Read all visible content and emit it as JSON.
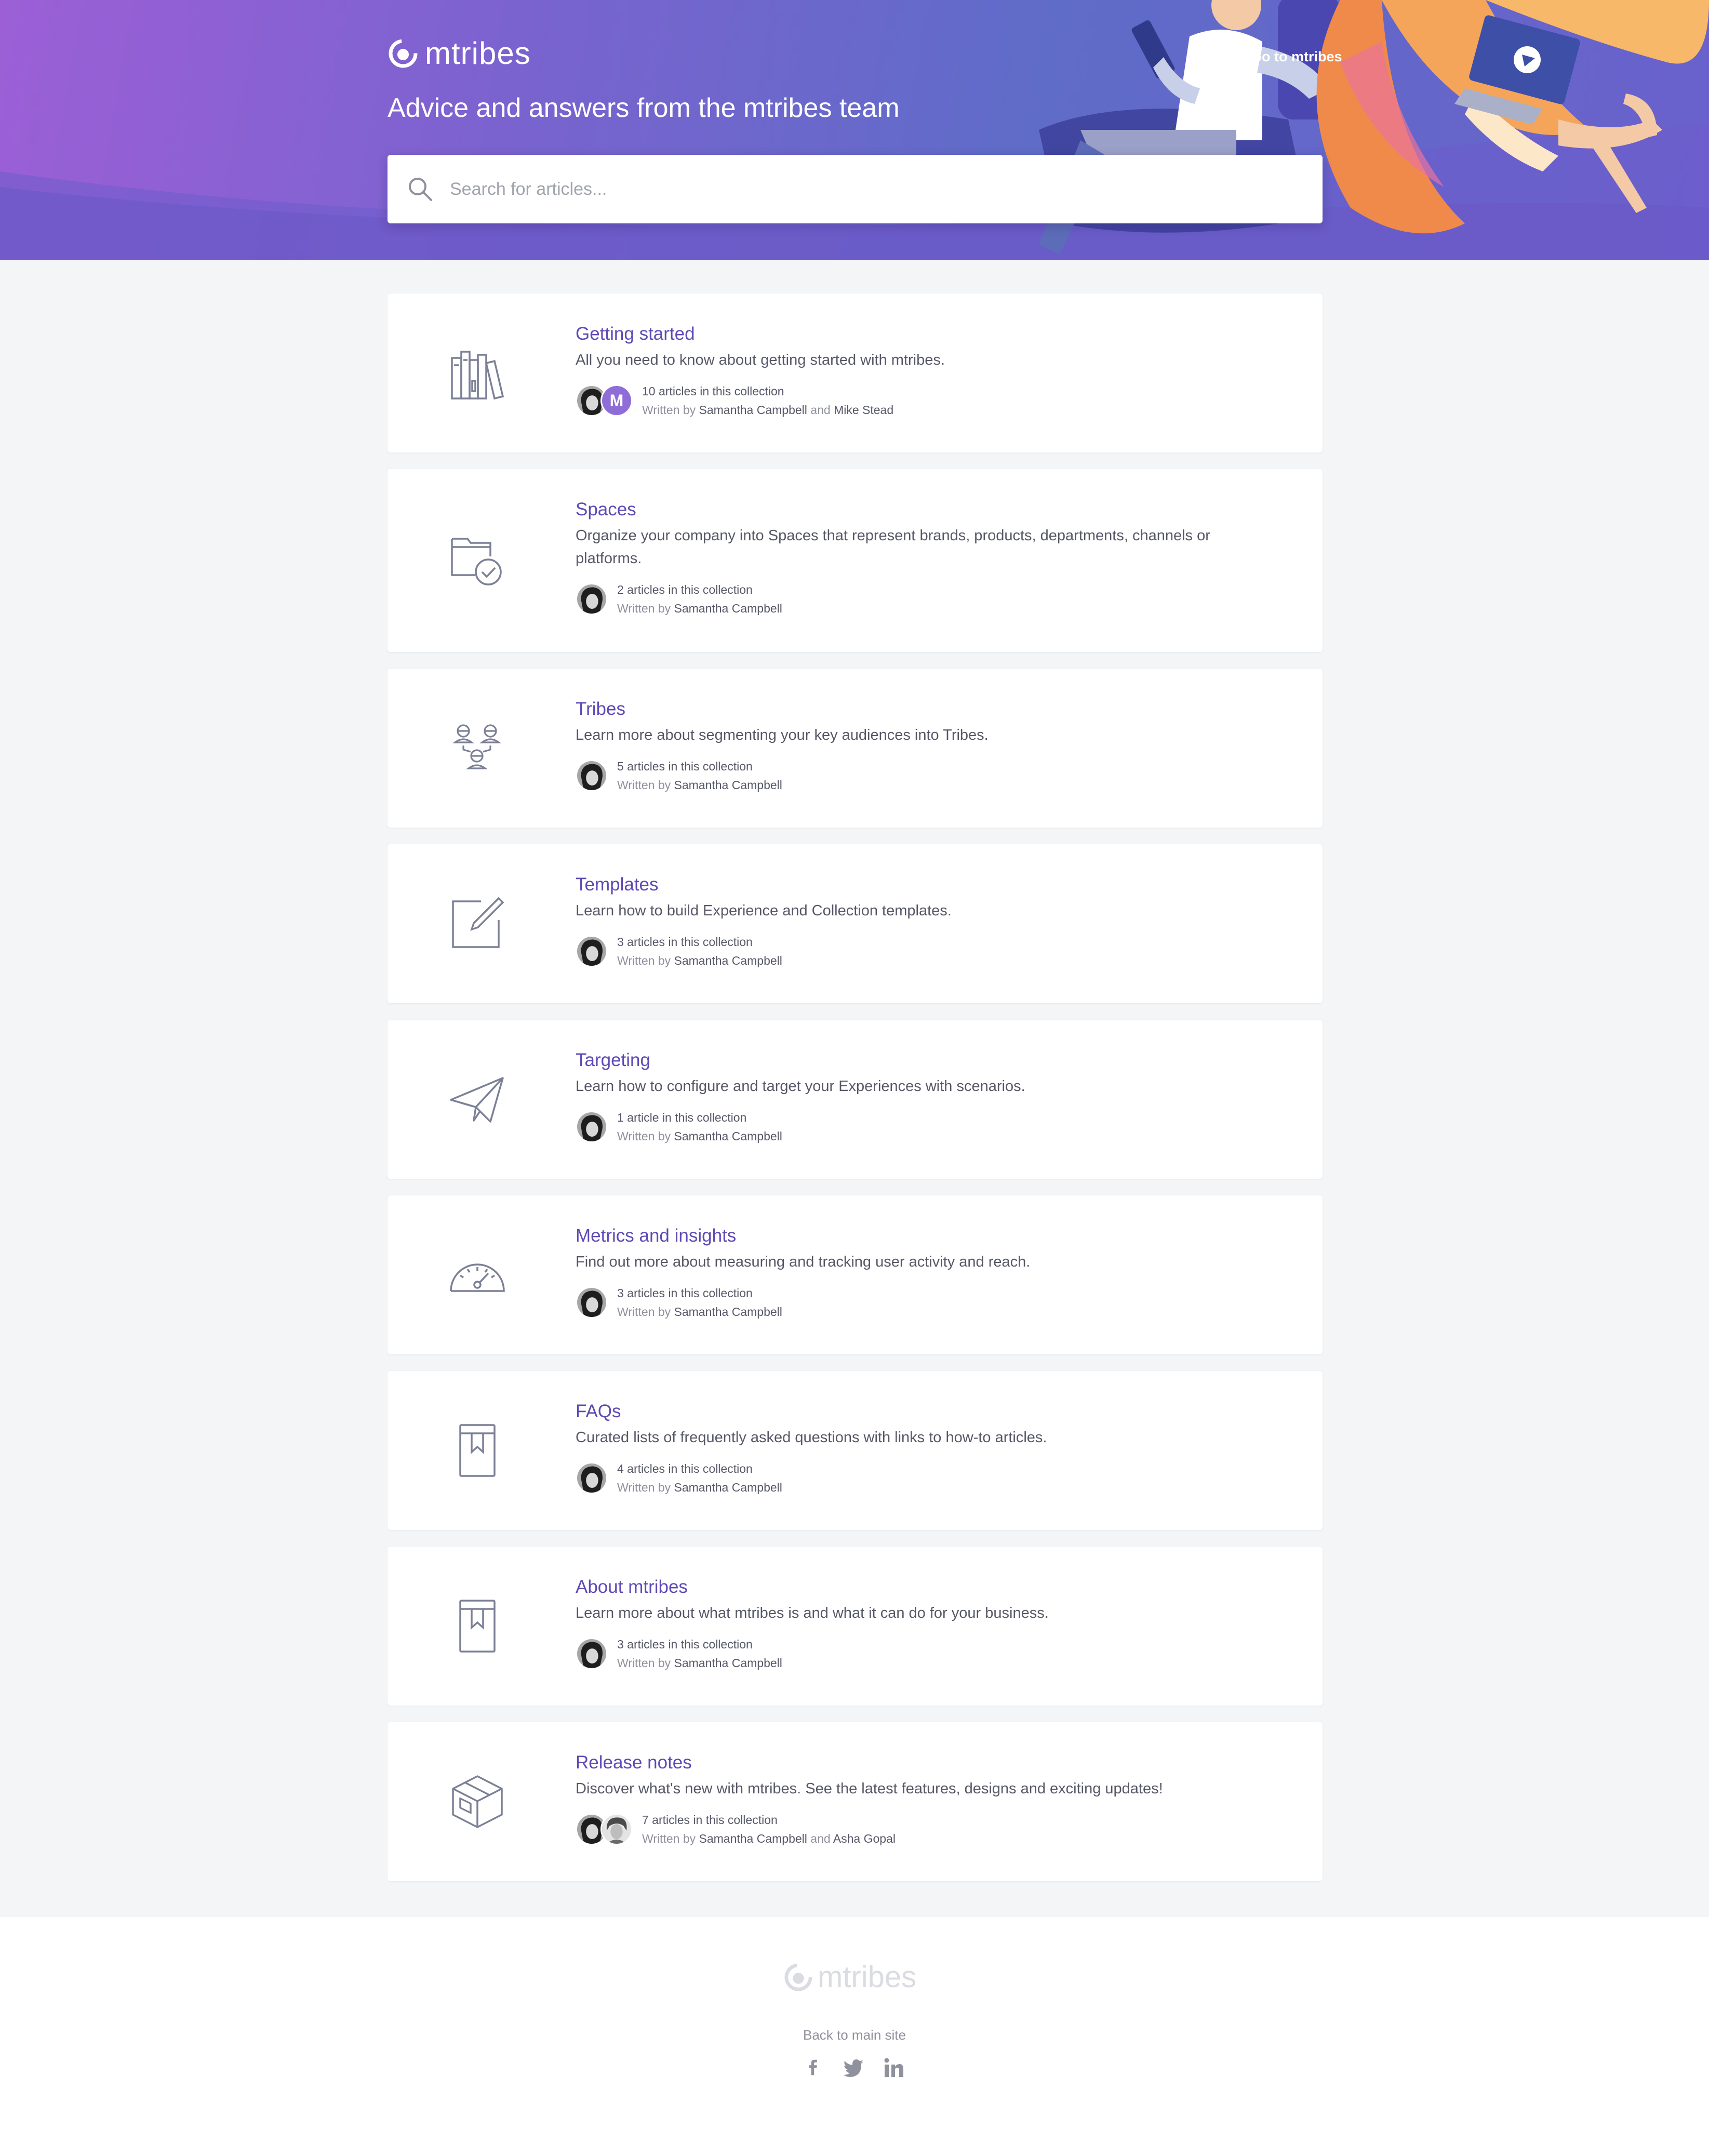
{
  "brand": {
    "name": "mtribes",
    "primary_color": "#5e49b6",
    "avatar_color": "#8f6dd6"
  },
  "header": {
    "tagline": "Advice and answers from the mtribes team",
    "go_link": "Go to mtribes",
    "search": {
      "placeholder": "Search for articles..."
    }
  },
  "collections": [
    {
      "icon": "books-icon",
      "title": "Getting started",
      "description": "All you need to know about getting started with mtribes.",
      "count": "10 articles in this collection",
      "written_by": "Written by",
      "authors": [
        "Samantha Campbell",
        "Mike Stead"
      ],
      "avatar_letter": "M"
    },
    {
      "icon": "folder-check-icon",
      "title": "Spaces",
      "description": "Organize your company into Spaces that represent brands, products, departments, channels or platforms.",
      "count": "2 articles in this collection",
      "written_by": "Written by",
      "authors": [
        "Samantha Campbell"
      ]
    },
    {
      "icon": "tribes-people-icon",
      "title": "Tribes",
      "description": "Learn more about segmenting your key audiences into Tribes.",
      "count": "5 articles in this collection",
      "written_by": "Written by",
      "authors": [
        "Samantha Campbell"
      ]
    },
    {
      "icon": "edit-icon",
      "title": "Templates",
      "description": "Learn how to build Experience and Collection templates.",
      "count": "3 articles in this collection",
      "written_by": "Written by",
      "authors": [
        "Samantha Campbell"
      ]
    },
    {
      "icon": "paper-plane-icon",
      "title": "Targeting",
      "description": "Learn how to configure and target your Experiences with scenarios.",
      "count": "1 article in this collection",
      "written_by": "Written by",
      "authors": [
        "Samantha Campbell"
      ]
    },
    {
      "icon": "speedometer-icon",
      "title": "Metrics and insights",
      "description": "Find out more about measuring and tracking user activity and reach.",
      "count": "3 articles in this collection",
      "written_by": "Written by",
      "authors": [
        "Samantha Campbell"
      ]
    },
    {
      "icon": "bookmark-book-icon",
      "title": "FAQs",
      "description": "Curated lists of frequently asked questions with links to how-to articles.",
      "count": "4 articles in this collection",
      "written_by": "Written by",
      "authors": [
        "Samantha Campbell"
      ]
    },
    {
      "icon": "bookmark-book-icon",
      "title": "About mtribes",
      "description": "Learn more about what mtribes is and what it can do for your business.",
      "count": "3 articles in this collection",
      "written_by": "Written by",
      "authors": [
        "Samantha Campbell"
      ]
    },
    {
      "icon": "box-icon",
      "title": "Release notes",
      "description": "Discover what's new with mtribes. See the latest features, designs and exciting updates!",
      "count": "7 articles in this collection",
      "written_by": "Written by",
      "authors": [
        "Samantha Campbell",
        "Asha Gopal"
      ]
    }
  ],
  "footer": {
    "brand": "mtribes",
    "back_link": "Back to main site",
    "social": [
      "facebook-icon",
      "twitter-icon",
      "linkedin-icon"
    ]
  }
}
